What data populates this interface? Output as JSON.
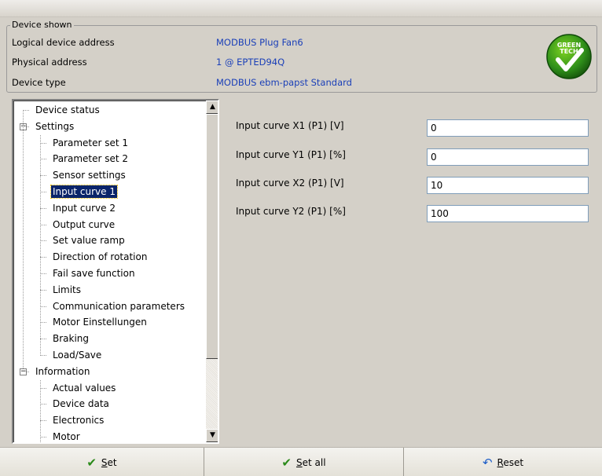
{
  "device": {
    "legend": "Device shown",
    "rows": [
      {
        "key": "Logical device address",
        "value": "MODBUS Plug Fan6"
      },
      {
        "key": "Physical address",
        "value": "1 @ EPTED94Q"
      },
      {
        "key": "Device type",
        "value": "MODBUS ebm-papst Standard"
      }
    ],
    "badge": {
      "line1": "GREEN",
      "line2": "TECH",
      "icon": "checkmark-icon"
    }
  },
  "tree": {
    "items": [
      {
        "label": "Device status",
        "level": 0
      },
      {
        "label": "Settings",
        "level": 0,
        "expanded": true
      },
      {
        "label": "Parameter set 1",
        "level": 1
      },
      {
        "label": "Parameter set 2",
        "level": 1
      },
      {
        "label": "Sensor settings",
        "level": 1
      },
      {
        "label": "Input curve 1",
        "level": 1,
        "selected": true
      },
      {
        "label": "Input curve 2",
        "level": 1
      },
      {
        "label": "Output curve",
        "level": 1
      },
      {
        "label": "Set value ramp",
        "level": 1
      },
      {
        "label": "Direction of rotation",
        "level": 1
      },
      {
        "label": "Fail save function",
        "level": 1
      },
      {
        "label": "Limits",
        "level": 1
      },
      {
        "label": "Communication parameters",
        "level": 1
      },
      {
        "label": "Motor Einstellungen",
        "level": 1
      },
      {
        "label": "Braking",
        "level": 1
      },
      {
        "label": "Load/Save",
        "level": 1
      },
      {
        "label": "Information",
        "level": 0,
        "expanded": true
      },
      {
        "label": "Actual values",
        "level": 1
      },
      {
        "label": "Device data",
        "level": 1
      },
      {
        "label": "Electronics",
        "level": 1
      },
      {
        "label": "Motor",
        "level": 1
      }
    ]
  },
  "form": {
    "fields": [
      {
        "label": "Input curve X1 (P1) [V]",
        "value": "0"
      },
      {
        "label": "Input curve Y1 (P1) [%]",
        "value": "0"
      },
      {
        "label": "Input curve X2 (P1) [V]",
        "value": "10"
      },
      {
        "label": "Input curve Y2 (P1) [%]",
        "value": "100"
      }
    ]
  },
  "buttons": {
    "set": {
      "label": "Set",
      "icon": "checkmark-icon"
    },
    "set_all": {
      "label": "Set all",
      "icon": "checkmark-icon"
    },
    "reset": {
      "label": "Reset",
      "icon": "reset-arrow-icon"
    }
  },
  "colors": {
    "link_blue": "#1a3fb8",
    "selection": "#0a246a",
    "background": "#d4d0c8"
  }
}
